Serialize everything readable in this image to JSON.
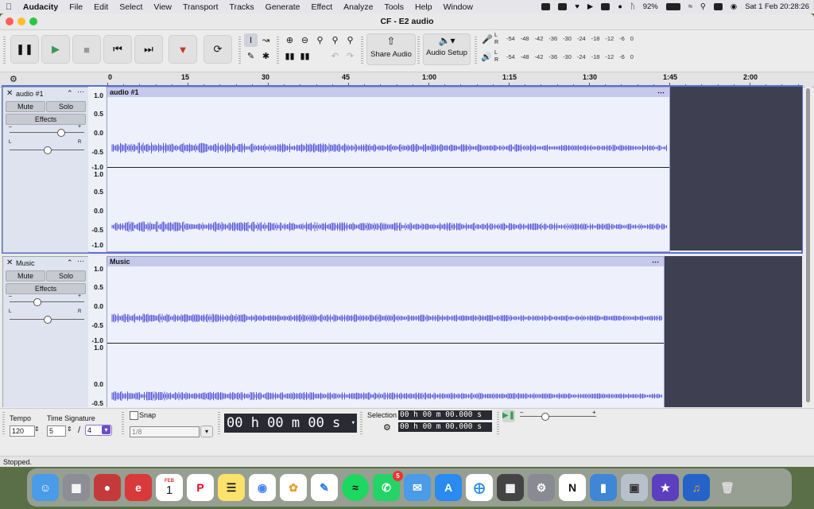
{
  "menubar": {
    "app": "Audacity",
    "items": [
      "File",
      "Edit",
      "Select",
      "View",
      "Transport",
      "Tracks",
      "Generate",
      "Effect",
      "Analyze",
      "Tools",
      "Help",
      "Window"
    ],
    "battery": "92%",
    "datetime": "Sat 1 Feb  20:28:26"
  },
  "window": {
    "title": "CF - E2 audio"
  },
  "toolbar": {
    "share_label": "Share Audio",
    "setup_label": "Audio Setup",
    "meter_ticks": [
      "-54",
      "-48",
      "-42",
      "-36",
      "-30",
      "-24",
      "-18",
      "-12",
      "-6",
      "0"
    ],
    "meter_rec_label_l": "L",
    "meter_rec_label_r": "R"
  },
  "ruler": {
    "labels": [
      "0",
      "15",
      "30",
      "45",
      "1:00",
      "1:15",
      "1:30",
      "1:45",
      "2:00"
    ]
  },
  "tracks": [
    {
      "name": "audio #1",
      "clip_name": "audio #1",
      "mute": "Mute",
      "solo": "Solo",
      "effects": "Effects",
      "gain_level": 0.7,
      "pan_level": 0.5,
      "scale": [
        "1.0",
        "0.5",
        "0.0",
        "-0.5",
        "-1.0"
      ]
    },
    {
      "name": "Music",
      "clip_name": "Music",
      "mute": "Mute",
      "solo": "Solo",
      "effects": "Effects",
      "gain_level": 0.35,
      "pan_level": 0.5,
      "scale": [
        "1.0",
        "0.5",
        "0.0",
        "-0.5",
        "-1.0"
      ]
    }
  ],
  "bottom": {
    "tempo_label": "Tempo",
    "tempo_value": "120",
    "timesig_label": "Time Signature",
    "timesig_num": "5",
    "timesig_den": "4",
    "timesig_slash": "/",
    "snap_label": "Snap",
    "snap_value": "1/8",
    "time_display": "00 h 00 m 00 s",
    "selection_label": "Selection",
    "sel_start": "00 h 00 m 00.000 s",
    "sel_end": "00 h 00 m 00.000 s"
  },
  "status": "Stopped.",
  "dock": {
    "apps": [
      "Finder",
      "Launchpad",
      "Photo Booth",
      "Expensify",
      "Calendar",
      "Pinterest",
      "Notes",
      "Chrome",
      "Photos",
      "Freeform",
      "Spotify",
      "WhatsApp",
      "Mail",
      "App Store",
      "Safari",
      "Calculator",
      "System Settings",
      "Notion",
      "Preview",
      "Screenshot",
      "iMovie",
      "Audacity",
      "Trash"
    ],
    "calendar_month": "FEB",
    "calendar_day": "1",
    "whatsapp_badge": "5"
  },
  "colors": {
    "waveform": "#5b5bd6",
    "clip_bg": "#eef0fc",
    "selected_border": "#5a6fd8"
  }
}
